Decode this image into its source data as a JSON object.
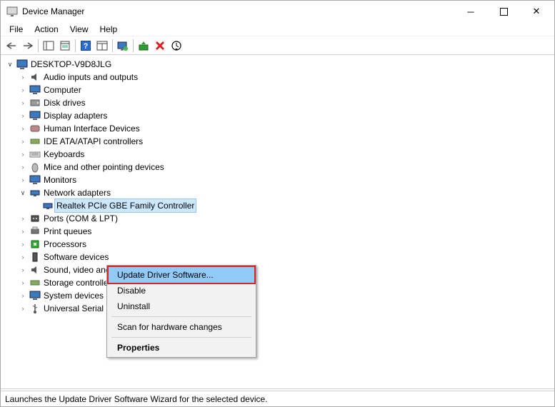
{
  "window": {
    "title": "Device Manager"
  },
  "menubar": [
    "File",
    "Action",
    "View",
    "Help"
  ],
  "tree": {
    "root": "DESKTOP-V9D8JLG",
    "categories": [
      {
        "label": "Audio inputs and outputs"
      },
      {
        "label": "Computer"
      },
      {
        "label": "Disk drives"
      },
      {
        "label": "Display adapters"
      },
      {
        "label": "Human Interface Devices"
      },
      {
        "label": "IDE ATA/ATAPI controllers"
      },
      {
        "label": "Keyboards"
      },
      {
        "label": "Mice and other pointing devices"
      },
      {
        "label": "Monitors"
      },
      {
        "label": "Network adapters",
        "expanded": true,
        "children": [
          {
            "label": "Realtek PCIe GBE Family Controller",
            "selected": true
          }
        ]
      },
      {
        "label": "Ports (COM & LPT)"
      },
      {
        "label": "Print queues"
      },
      {
        "label": "Processors"
      },
      {
        "label": "Software devices"
      },
      {
        "label": "Sound, video and game controllers"
      },
      {
        "label": "Storage controllers"
      },
      {
        "label": "System devices"
      },
      {
        "label": "Universal Serial Bus controllers"
      }
    ]
  },
  "context_menu": {
    "update": "Update Driver Software...",
    "disable": "Disable",
    "uninstall": "Uninstall",
    "scan": "Scan for hardware changes",
    "properties": "Properties"
  },
  "statusbar": "Launches the Update Driver Software Wizard for the selected device."
}
